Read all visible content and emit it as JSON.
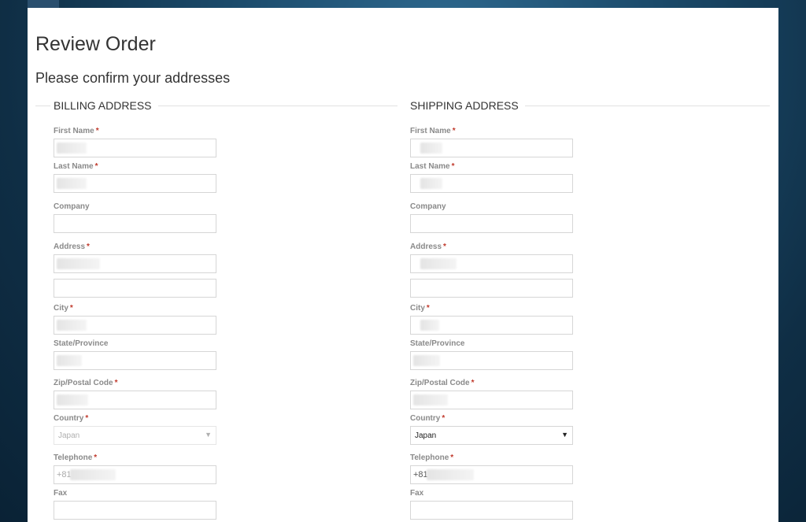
{
  "page": {
    "title": "Review Order",
    "subtitle": "Please confirm your addresses"
  },
  "billing": {
    "legend": "BILLING ADDRESS",
    "fields": {
      "first_name": "First Name",
      "last_name": "Last Name",
      "company": "Company",
      "address": "Address",
      "city": "City",
      "state": "State/Province",
      "zip": "Zip/Postal Code",
      "country": "Country",
      "telephone": "Telephone",
      "fax": "Fax"
    },
    "country_value": "Japan",
    "telephone_prefix": "+81"
  },
  "shipping": {
    "legend": "SHIPPING ADDRESS",
    "fields": {
      "first_name": "First Name",
      "last_name": "Last Name",
      "company": "Company",
      "address": "Address",
      "city": "City",
      "state": "State/Province",
      "zip": "Zip/Postal Code",
      "country": "Country",
      "telephone": "Telephone",
      "fax": "Fax"
    },
    "country_value": "Japan",
    "telephone_prefix": "+81"
  },
  "ui": {
    "required_mark": "*",
    "select_caret": "▼"
  }
}
